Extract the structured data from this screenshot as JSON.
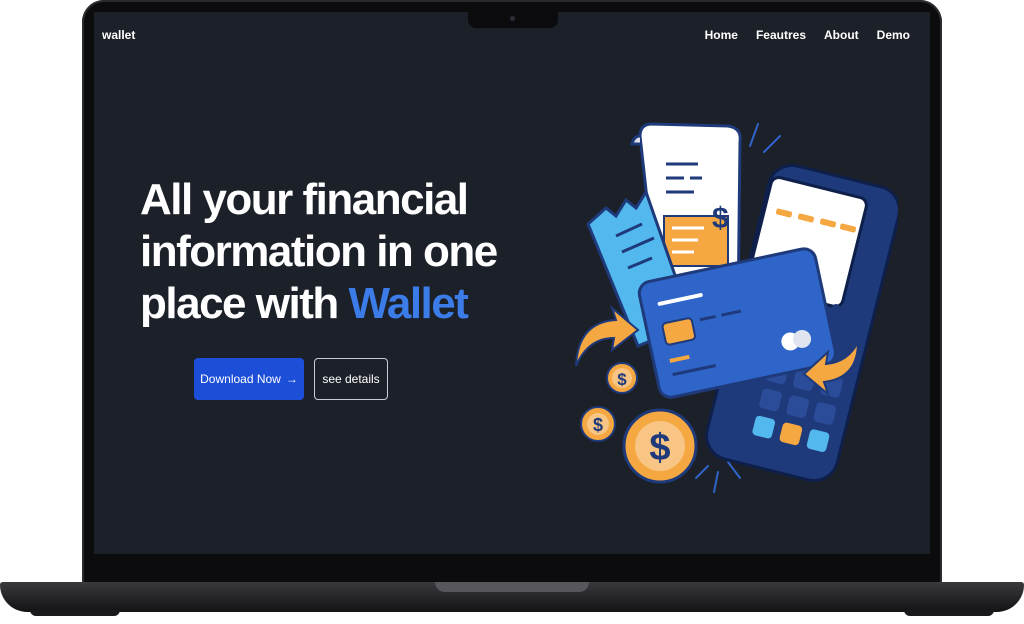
{
  "nav": {
    "brand": "wallet",
    "links": [
      "Home",
      "Feautres",
      "About",
      "Demo"
    ]
  },
  "hero": {
    "title_line1": "All your financial",
    "title_line2": "information in one",
    "title_line3_prefix": "place with",
    "title_highlight": "Wallet",
    "primary_button": "Download Now",
    "primary_button_arrow": "→",
    "secondary_button": "see details"
  },
  "illustration": {
    "currency_symbol": "$"
  },
  "colors": {
    "background": "#1c2029",
    "accent": "#3b7ce8",
    "primary_button": "#1d4ed8",
    "coin": "#f5a742",
    "card": "#2f64c9"
  }
}
